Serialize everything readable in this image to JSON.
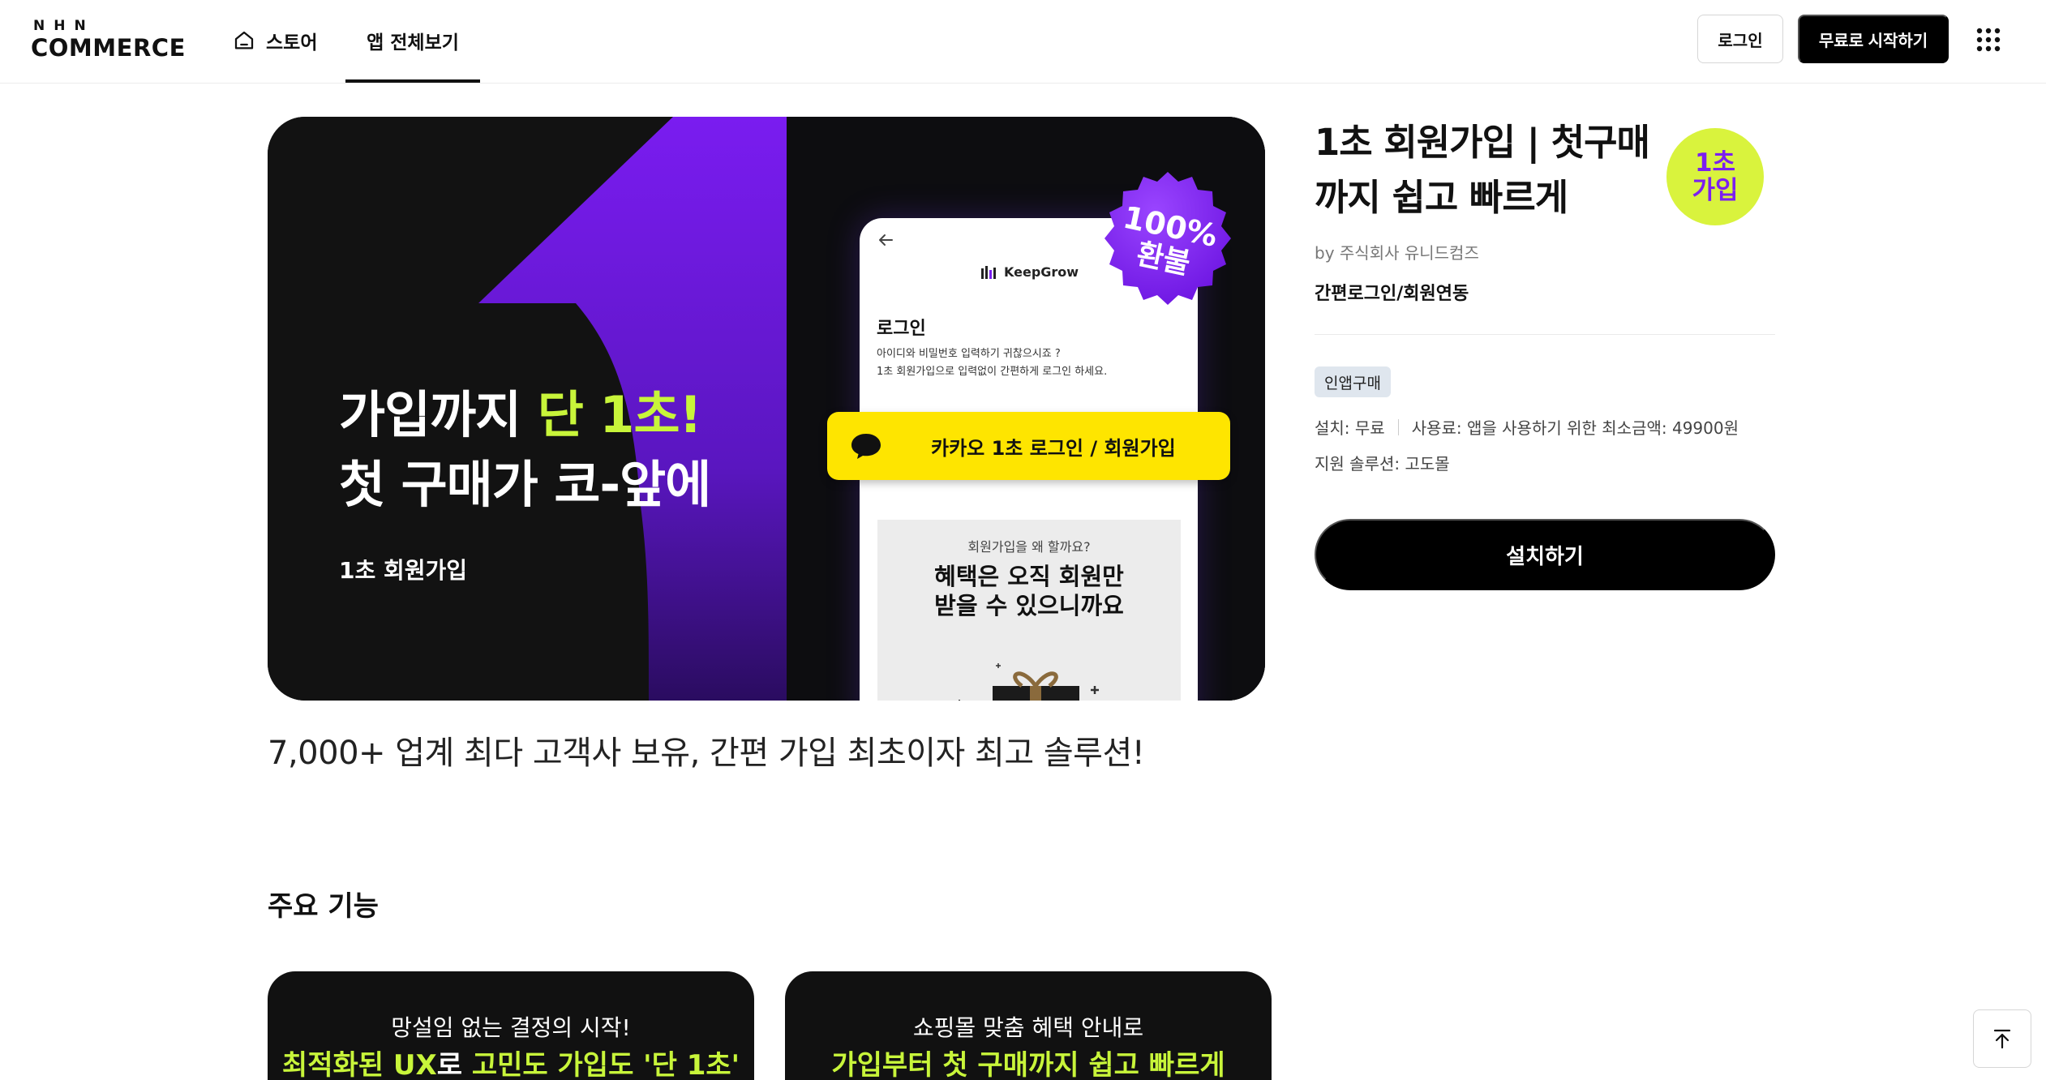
{
  "header": {
    "logo_top": "NHN",
    "logo_bottom": "COMMERCE",
    "nav": [
      {
        "label": "스토어",
        "icon": "home-icon"
      },
      {
        "label": "앱 전체보기",
        "active": true
      }
    ],
    "login_label": "로그인",
    "start_label": "무료로 시작하기",
    "menu_icon": "grid-icon"
  },
  "banner": {
    "headline_1a": "가입까지 ",
    "headline_1b": "단 1초!",
    "headline_2a": "첫 구매가 코-",
    "headline_2b": "앞에",
    "brand": "1초 회원가입",
    "phone": {
      "brand": "KeepGrow",
      "login_title": "로그인",
      "login_desc_1": "아이디와 비밀번호 입력하기 귀찮으시죠 ?",
      "login_desc_2": "1초 회원가입으로 입력없이 간편하게 로그인 하세요.",
      "promo_question": "회원가입을 왜 할까요?",
      "promo_main_1": "혜택은 오직 회원만",
      "promo_main_2": "받을 수 있으니까요"
    },
    "kakao_label": "카카오 1초 로그인 / 회원가입",
    "badge_1": "100%",
    "badge_2": "환불",
    "colors": {
      "purple": "#7b1ff0",
      "lime": "#c8f53a",
      "kakao": "#fee500"
    }
  },
  "tagline": "7,000+ 업계 최다 고객사 보유, 간편 가입 최초이자 최고 솔루션!",
  "app": {
    "title_1": "1초 회원가입 | 첫구매",
    "title_2": "까지 쉽고 빠르게",
    "icon_line_1": "1초",
    "icon_line_2": "가입",
    "developer": "by 주식회사 유니드컴즈",
    "category": "간편로그인/회원연동",
    "badge": "인앱구매",
    "install_fee": "설치: 무료",
    "usage_fee": "사용료: 앱을 사용하기 위한 최소금액: 49900원",
    "support": "지원 솔루션: 고도몰",
    "install_label": "설치하기"
  },
  "features": {
    "heading": "주요 기능",
    "cards": [
      {
        "sub": "망설임 없는 결정의 시작!",
        "main_a": "최적화된 UX",
        "main_b": "로 ",
        "main_c": "고민도 가입도 '단 1초'"
      },
      {
        "sub": "쇼핑몰 맞춤 혜택 안내로",
        "main_a": "가입부터 첫 구매까지 쉽고 빠르게",
        "main_b": "",
        "main_c": ""
      }
    ]
  },
  "to_top_icon": "arrow-up-to-top-icon"
}
